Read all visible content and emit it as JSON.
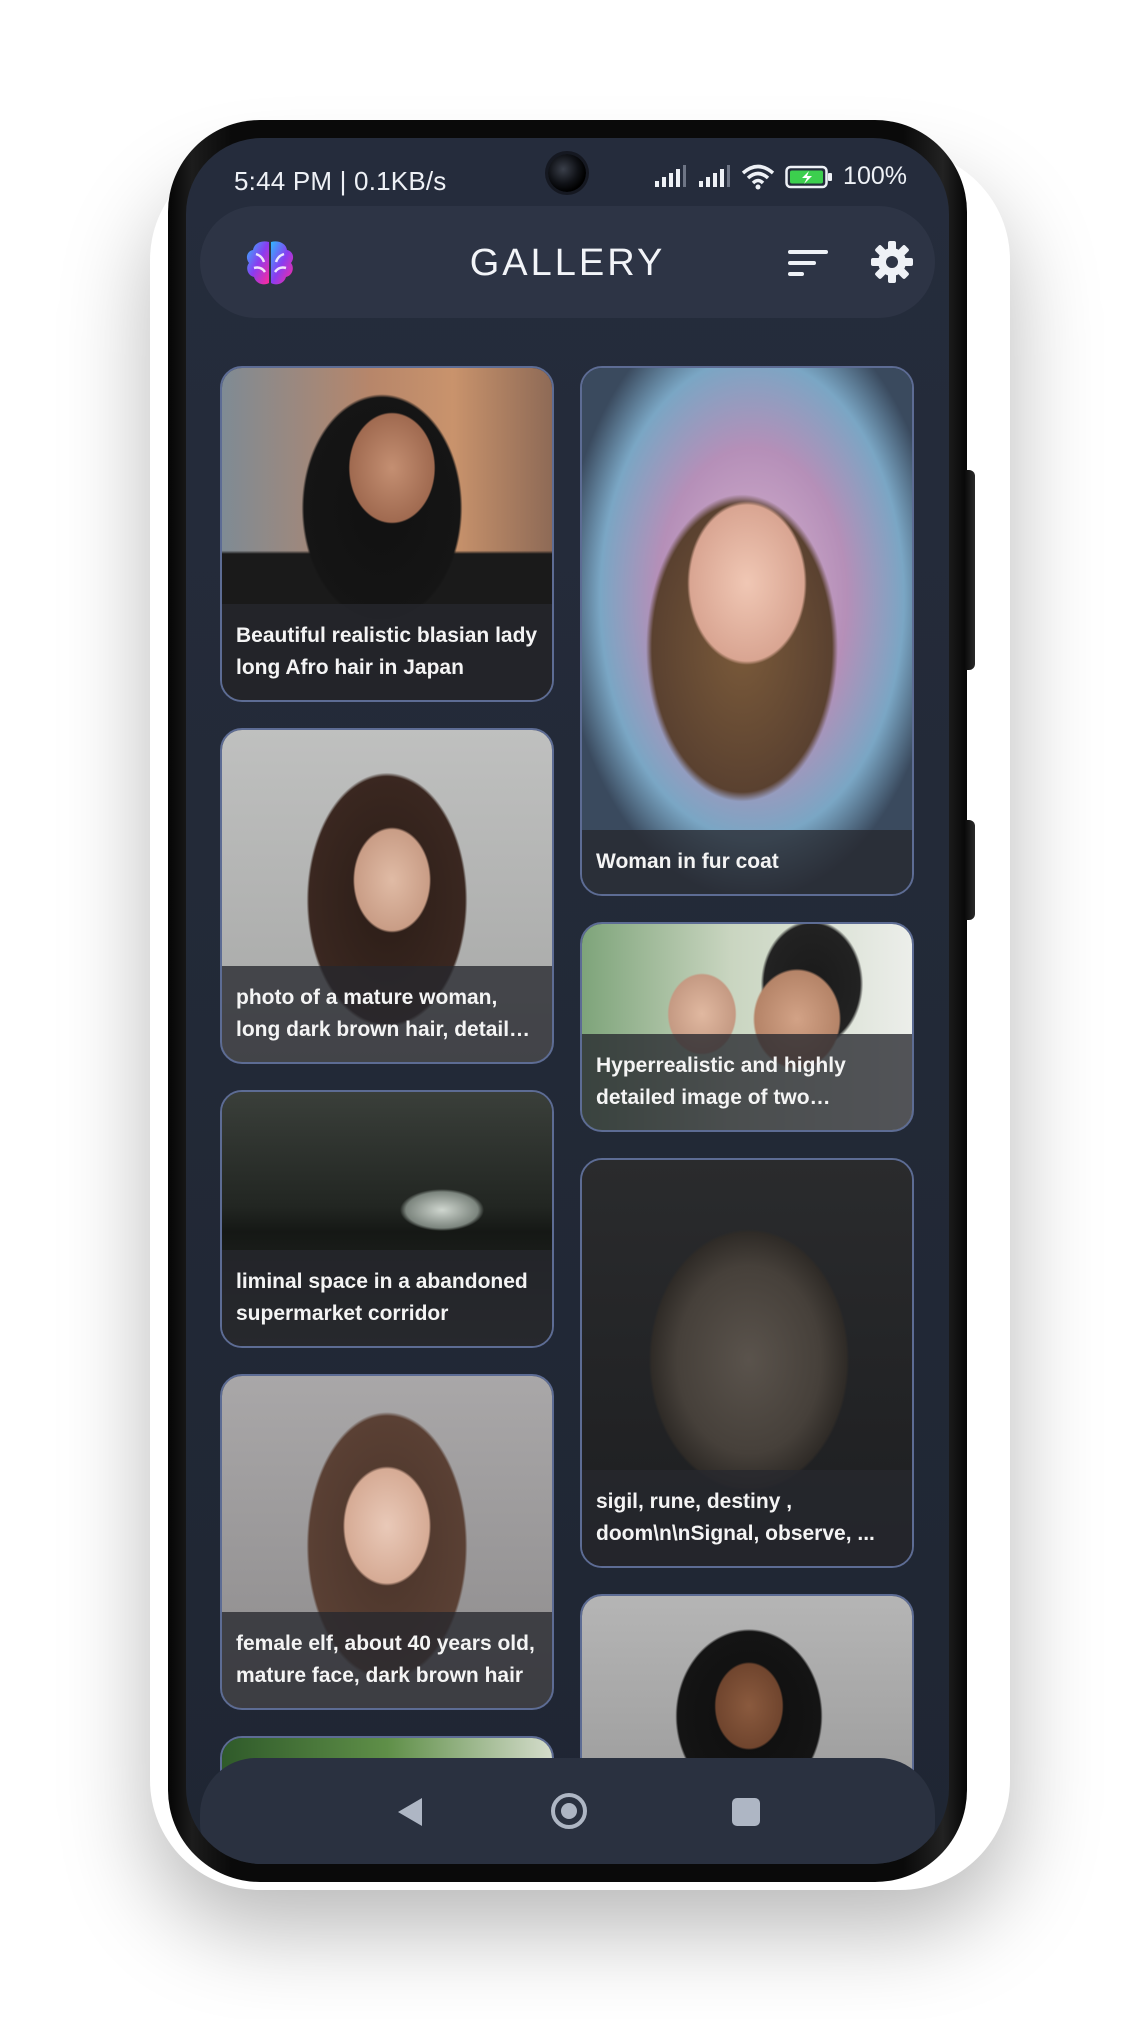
{
  "status_bar": {
    "time_speed": "5:44 PM | 0.1KB/s",
    "battery_percent": "100%"
  },
  "app_bar": {
    "title": "GALLERY",
    "icons": [
      "brain-logo-icon",
      "sort-icon",
      "gear-icon"
    ]
  },
  "gallery": {
    "items": [
      {
        "caption": "Beautiful realistic blasian lady long Afro hair in Japan"
      },
      {
        "caption": "Woman in fur coat"
      },
      {
        "caption": "photo of a mature woman, long dark brown hair, detailed face"
      },
      {
        "caption": "Hyperrealistic and highly detailed image of two teenagers kissing"
      },
      {
        "caption": "liminal space in a abandoned supermarket corridor"
      },
      {
        "caption": "sigil, rune, destiny , doom\\n\\nSignal, observe, ..."
      },
      {
        "caption": "female elf, about 40 years old, mature face, dark brown hair"
      }
    ]
  },
  "nav_bar": {
    "icons": [
      "back-icon",
      "home-icon",
      "recents-icon"
    ]
  },
  "colors": {
    "background": "#232a38",
    "bar": "#2d3445",
    "card_border": "#5d6c94",
    "accent_magenta": "#e02aa8",
    "accent_blue": "#3a6df0"
  }
}
